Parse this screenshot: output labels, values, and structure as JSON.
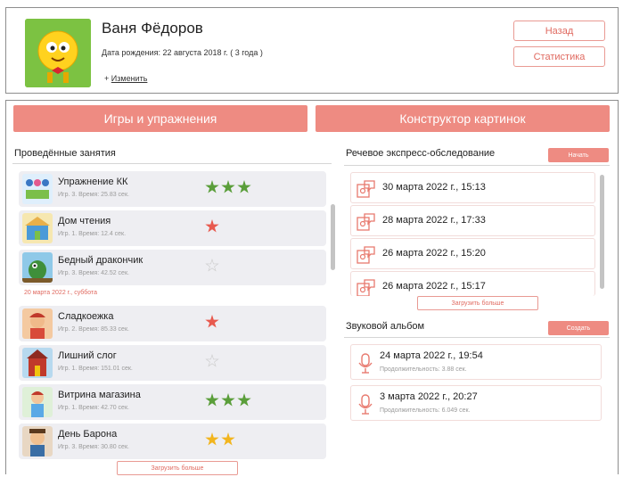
{
  "profile": {
    "name": "Ваня Фёдоров",
    "birth": "Дата рождения: 22 августа 2018 г. ( 3 года )",
    "edit_prefix": "+",
    "edit_label": "Изменить"
  },
  "header_buttons": {
    "back": "Назад",
    "stats": "Статистика"
  },
  "tabs": {
    "games": "Игры и упражнения",
    "constructor": "Конструктор картинок"
  },
  "lessons": {
    "title": "Проведённые занятия",
    "date_divider": "20 марта 2022 г., суббота",
    "load_more": "Загрузить больше",
    "items": [
      {
        "title": "Упражнение КК",
        "meta": "Игр. 3. Время: 25.83 сек.",
        "stars": 3,
        "star_color": "green"
      },
      {
        "title": "Дом чтения",
        "meta": "Игр. 1. Время: 12.4 сек.",
        "stars": 1,
        "star_color": "red"
      },
      {
        "title": "Бедный дракончик",
        "meta": "Игр. 3. Время: 42.52 сек.",
        "stars": 0,
        "star_color": "gray"
      },
      {
        "title": "Сладкоежка",
        "meta": "Игр. 2. Время: 85.33 сек.",
        "stars": 1,
        "star_color": "red"
      },
      {
        "title": "Лишний слог",
        "meta": "Игр. 1. Время: 151.01 сек.",
        "stars": 0,
        "star_color": "gray"
      },
      {
        "title": "Витрина магазина",
        "meta": "Игр. 1. Время: 42.70 сек.",
        "stars": 3,
        "star_color": "green"
      },
      {
        "title": "День Барона",
        "meta": "Игр. 3. Время: 30.80 сек.",
        "stars": 2,
        "star_color": "yellow"
      }
    ]
  },
  "express": {
    "title": "Речевое экспресс-обследование",
    "start_label": "Начать",
    "load_more": "Загрузить больше",
    "items": [
      {
        "label": "30 марта 2022 г., 15:13"
      },
      {
        "label": "28 марта 2022 г., 17:33"
      },
      {
        "label": "26 марта 2022 г., 15:20"
      },
      {
        "label": "26 марта 2022 г., 15:17"
      }
    ]
  },
  "album": {
    "title": "Звуковой альбом",
    "create_label": "Создать",
    "items": [
      {
        "label": "24 марта 2022 г., 19:54",
        "duration": "Продолжительность: 3.88 сек."
      },
      {
        "label": "3 марта 2022 г., 20:27",
        "duration": "Продолжительность: 6.049 сек."
      }
    ]
  },
  "colors": {
    "accent": "#ee8b82",
    "accent_text": "#e06a60",
    "star_green": "#5a9e3a",
    "star_red": "#e85a4f",
    "star_yellow": "#f2b51e",
    "star_gray": "#cccccc",
    "avatar_bg": "#7cc242"
  }
}
